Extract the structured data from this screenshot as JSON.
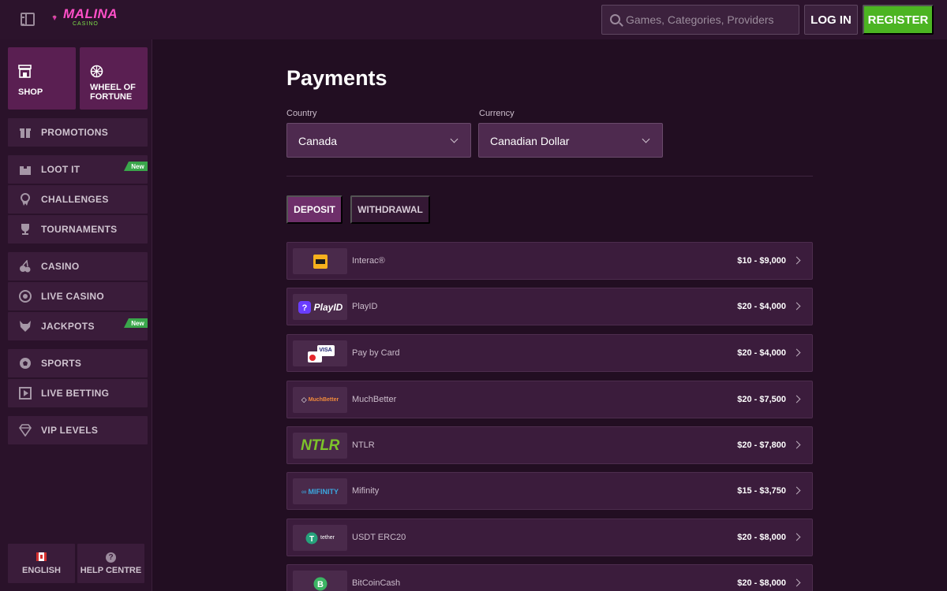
{
  "header": {
    "logo_text": "MALINA",
    "logo_sub": "CASINO",
    "search_placeholder": "Games, Categories, Providers",
    "login_label": "LOG IN",
    "register_label": "REGISTER"
  },
  "sidebar": {
    "tiles": [
      {
        "label": "SHOP",
        "icon": "shop-icon"
      },
      {
        "label": "WHEEL OF FORTUNE",
        "icon": "wheel-icon"
      }
    ],
    "items": [
      {
        "label": "PROMOTIONS",
        "icon": "gift-icon",
        "badge": ""
      },
      {
        "label": "LOOT IT",
        "icon": "box-icon",
        "badge": "New"
      },
      {
        "label": "CHALLENGES",
        "icon": "medal-icon",
        "badge": ""
      },
      {
        "label": "TOURNAMENTS",
        "icon": "trophy-icon",
        "badge": ""
      },
      {
        "label": "CASINO",
        "icon": "cherries-icon",
        "badge": ""
      },
      {
        "label": "LIVE CASINO",
        "icon": "chip-icon",
        "badge": ""
      },
      {
        "label": "JACKPOTS",
        "icon": "wolf-icon",
        "badge": "New"
      },
      {
        "label": "SPORTS",
        "icon": "football-icon",
        "badge": ""
      },
      {
        "label": "LIVE BETTING",
        "icon": "live-icon",
        "badge": ""
      },
      {
        "label": "VIP LEVELS",
        "icon": "diamond-icon",
        "badge": ""
      }
    ],
    "bottom": {
      "language_label": "ENGLISH",
      "help_label": "HELP CENTRE"
    }
  },
  "main": {
    "title": "Payments",
    "country_label": "Country",
    "country_value": "Canada",
    "currency_label": "Currency",
    "currency_value": "Canadian Dollar",
    "tabs": [
      {
        "label": "DEPOSIT",
        "active": true
      },
      {
        "label": "WITHDRAWAL",
        "active": false
      }
    ],
    "methods": [
      {
        "name": "Interac®",
        "range": "$10 - $9,000",
        "logo": "interac"
      },
      {
        "name": "PlayID",
        "range": "$20 - $4,000",
        "logo": "playid",
        "logo_text": "PlayID"
      },
      {
        "name": "Pay by Card",
        "range": "$20 - $4,000",
        "logo": "card",
        "logo_text": "VISA"
      },
      {
        "name": "MuchBetter",
        "range": "$20 - $7,500",
        "logo": "muchbetter",
        "logo_text": "MuchBetter"
      },
      {
        "name": "NTLR",
        "range": "$20 - $7,800",
        "logo": "ntlr",
        "logo_text": "NTLR"
      },
      {
        "name": "Mifinity",
        "range": "$15 - $3,750",
        "logo": "mifinity",
        "logo_text": "MIFINITY"
      },
      {
        "name": "USDT ERC20",
        "range": "$20 - $8,000",
        "logo": "tether",
        "logo_text": "tether"
      },
      {
        "name": "BitCoinCash",
        "range": "$20 - $8,000",
        "logo": "bch"
      }
    ]
  },
  "colors": {
    "background": "#220e22",
    "header": "#2c132c",
    "accent_pink": "#ff4fc8",
    "register_green": "#4cb422",
    "tab_active": "#6e2f6a",
    "badge_new": "#3aa64b"
  }
}
